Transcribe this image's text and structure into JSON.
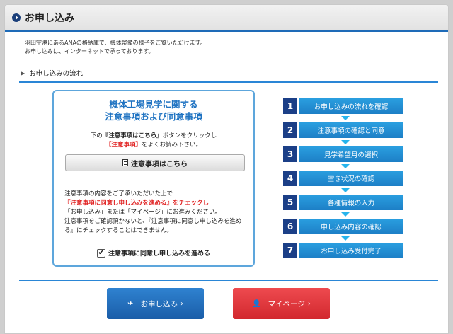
{
  "page": {
    "title": "お申し込み",
    "intro_lines": [
      "羽田空港にあるANAの格納庫で、機体整備の様子をご覧いただけます。",
      "お申し込みは、インターネットで承っております。"
    ],
    "section_title": "お申し込みの流れ"
  },
  "panel": {
    "title_line1": "機体工場見学に関する",
    "title_line2": "注意事項および同意事項",
    "p1_a": "下の",
    "p1_b": "『注意事項はこちら』",
    "p1_c": "ボタンをクリックし",
    "p1_d": "【注意事項】",
    "p1_e": "をよくお読み下さい。",
    "notice_button": "注意事項はこちら",
    "p2_a": "注意事項の内容をご了承いただいた上で",
    "p2_b": "『注意事項に同意し申し込みを進める』をチェックし",
    "p2_c": "「お申し込み」または「マイページ」にお進みください。",
    "p2_d": "注意事項をご確認頂かないと、『注意事項に同意し申し込みを進める』にチェックすることはできません。",
    "agree_label": "注意事項に同意し申し込みを進める",
    "agree_checked": true
  },
  "steps": [
    {
      "num": "1",
      "label": "お申し込みの流れを確認"
    },
    {
      "num": "2",
      "label": "注意事項の確認と同意"
    },
    {
      "num": "3",
      "label": "見学希望月の選択"
    },
    {
      "num": "4",
      "label": "空き状況の確認"
    },
    {
      "num": "5",
      "label": "各種情報の入力"
    },
    {
      "num": "6",
      "label": "申し込み内容の確認"
    },
    {
      "num": "7",
      "label": "お申し込み受付完了"
    }
  ],
  "buttons": {
    "apply": "お申し込み",
    "mypage": "マイページ"
  },
  "colors": {
    "accent_blue": "#1e6bb8",
    "step_blue": "#1d7fc6",
    "step_num": "#1b3f87",
    "mypage_red": "#d2282e"
  }
}
